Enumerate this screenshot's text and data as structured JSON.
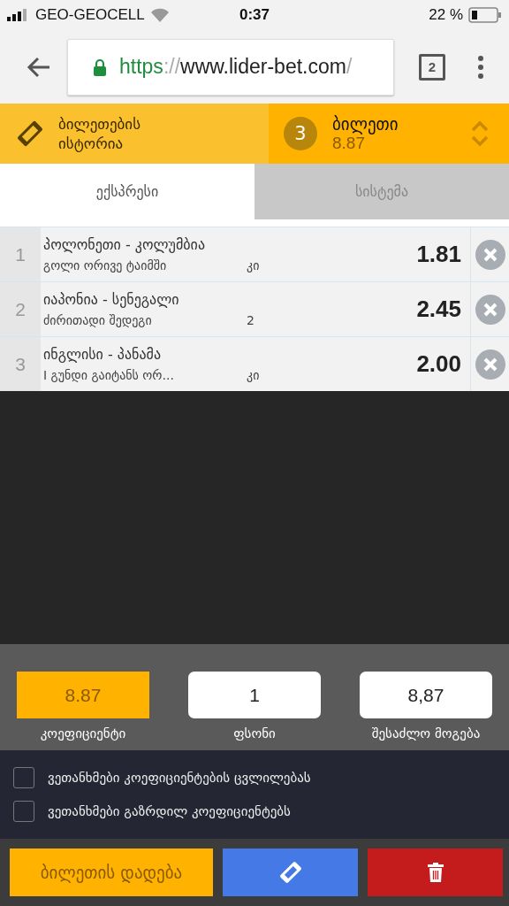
{
  "status_bar": {
    "carrier": "GEO-GEOCELL",
    "time": "0:37",
    "battery": "22 %"
  },
  "browser": {
    "url_scheme": "https",
    "url_sep": "://",
    "url_host": "www.lider-bet.com",
    "url_tail": "/",
    "tab_count": "2"
  },
  "header": {
    "history_label": "ბილეთების ისტორია",
    "ticket_count": "3",
    "ticket_label": "ბილეთი",
    "ticket_total": "8.87"
  },
  "tabs": [
    {
      "label": "ექსპრესი",
      "selected": true
    },
    {
      "label": "სისტემა",
      "selected": false
    }
  ],
  "bets": [
    {
      "index": "1",
      "match": "პოლონეთი - კოლუმბია",
      "market": "გოლი ორივე ტაიმში",
      "pick": "კი",
      "odds": "1.81"
    },
    {
      "index": "2",
      "match": "იაპონია - სენეგალი",
      "market": "ძირითადი შედეგი",
      "pick": "2",
      "odds": "2.45"
    },
    {
      "index": "3",
      "match": "ინგლისი - პანამა",
      "market": "I გუნდი გაიტანს ორ...",
      "pick": "კი",
      "odds": "2.00"
    }
  ],
  "summary": [
    {
      "value": "8.87",
      "label": "კოეფიციენტი",
      "kind": "display"
    },
    {
      "value": "1",
      "label": "ფსონი",
      "kind": "input"
    },
    {
      "value": "8,87",
      "label": "შესაძლო მოგება",
      "kind": "input"
    }
  ],
  "options": [
    {
      "label": "ვეთანხმები კოეფიციენტების ცვლილებას",
      "checked": false
    },
    {
      "label": "ვეთანხმები გაზრდილ კოეფიციენტებს",
      "checked": false
    }
  ],
  "actions": {
    "place_label": "ბილეთის დადება"
  }
}
